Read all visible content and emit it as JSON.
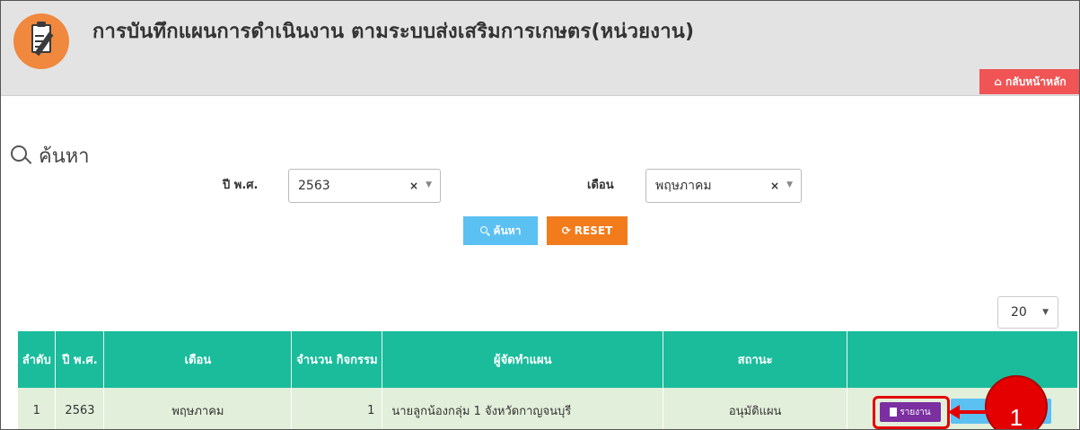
{
  "header": {
    "title": "การบันทึกแผนการดำเนินงาน ตามระบบส่งเสริมการเกษตร(หน่วยงาน)",
    "home_button": "กลับหน้าหลัก",
    "logo_icon": "clipboard-icon",
    "home_icon": "home-icon"
  },
  "search": {
    "heading": "ค้นหา",
    "year_label": "ปี พ.ศ.",
    "year_value": "2563",
    "month_label": "เดือน",
    "month_value": "พฤษภาคม",
    "search_button": "ค้นหา",
    "reset_button": "RESET"
  },
  "page_size": "20",
  "table": {
    "headers": [
      "ลำดับ",
      "ปี พ.ศ.",
      "เดือน",
      "จำนวน กิจกรรม",
      "ผู้จัดทำแผน",
      "สถานะ",
      ""
    ],
    "rows": [
      {
        "no": "1",
        "year": "2563",
        "month": "พฤษภาคม",
        "count": "1",
        "maker": "นายลูกน้องกลุ่ม 1 จังหวัดกาญจนบุรี",
        "status": "อนุมัติแผน",
        "report_button": "รายงาน"
      }
    ]
  },
  "annotation": {
    "marker_number": "1"
  },
  "colors": {
    "accent_teal": "#1abc9c",
    "home_red": "#f05454",
    "search_blue": "#5bc0f2",
    "reset_orange": "#f27c1c",
    "report_purple": "#7b2fa0",
    "annotation_red": "#e40000"
  }
}
